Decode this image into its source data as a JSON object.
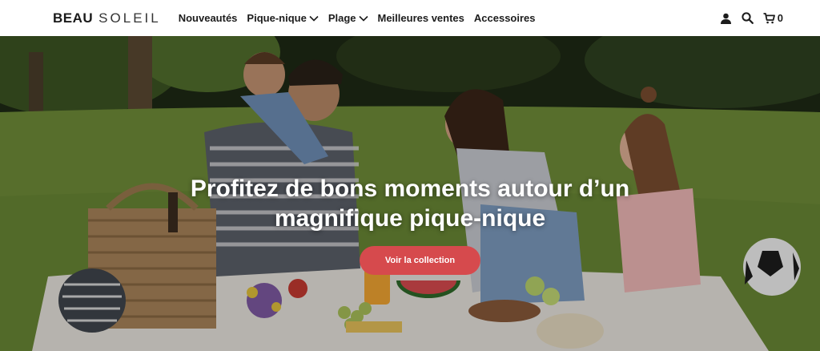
{
  "brand": {
    "name_bold": "BEAU",
    "name_light": "SOLEIL"
  },
  "nav": {
    "items": [
      {
        "label": "Nouveautés",
        "has_dropdown": false
      },
      {
        "label": "Pique-nique",
        "has_dropdown": true
      },
      {
        "label": "Plage",
        "has_dropdown": true
      },
      {
        "label": "Meilleures ventes",
        "has_dropdown": false
      },
      {
        "label": "Accessoires",
        "has_dropdown": false
      }
    ]
  },
  "header_icons": {
    "account": "user-icon",
    "search": "search-icon",
    "cart": "cart-icon",
    "cart_count": "0"
  },
  "hero": {
    "title_line1": "Profitez de bons moments autour d’un",
    "title_line2": "magnifique pique-nique",
    "cta_label": "Voir la collection"
  },
  "colors": {
    "cta_background": "#d64a4d",
    "header_background": "#ffffff",
    "text_dark": "#1c1c1c"
  }
}
